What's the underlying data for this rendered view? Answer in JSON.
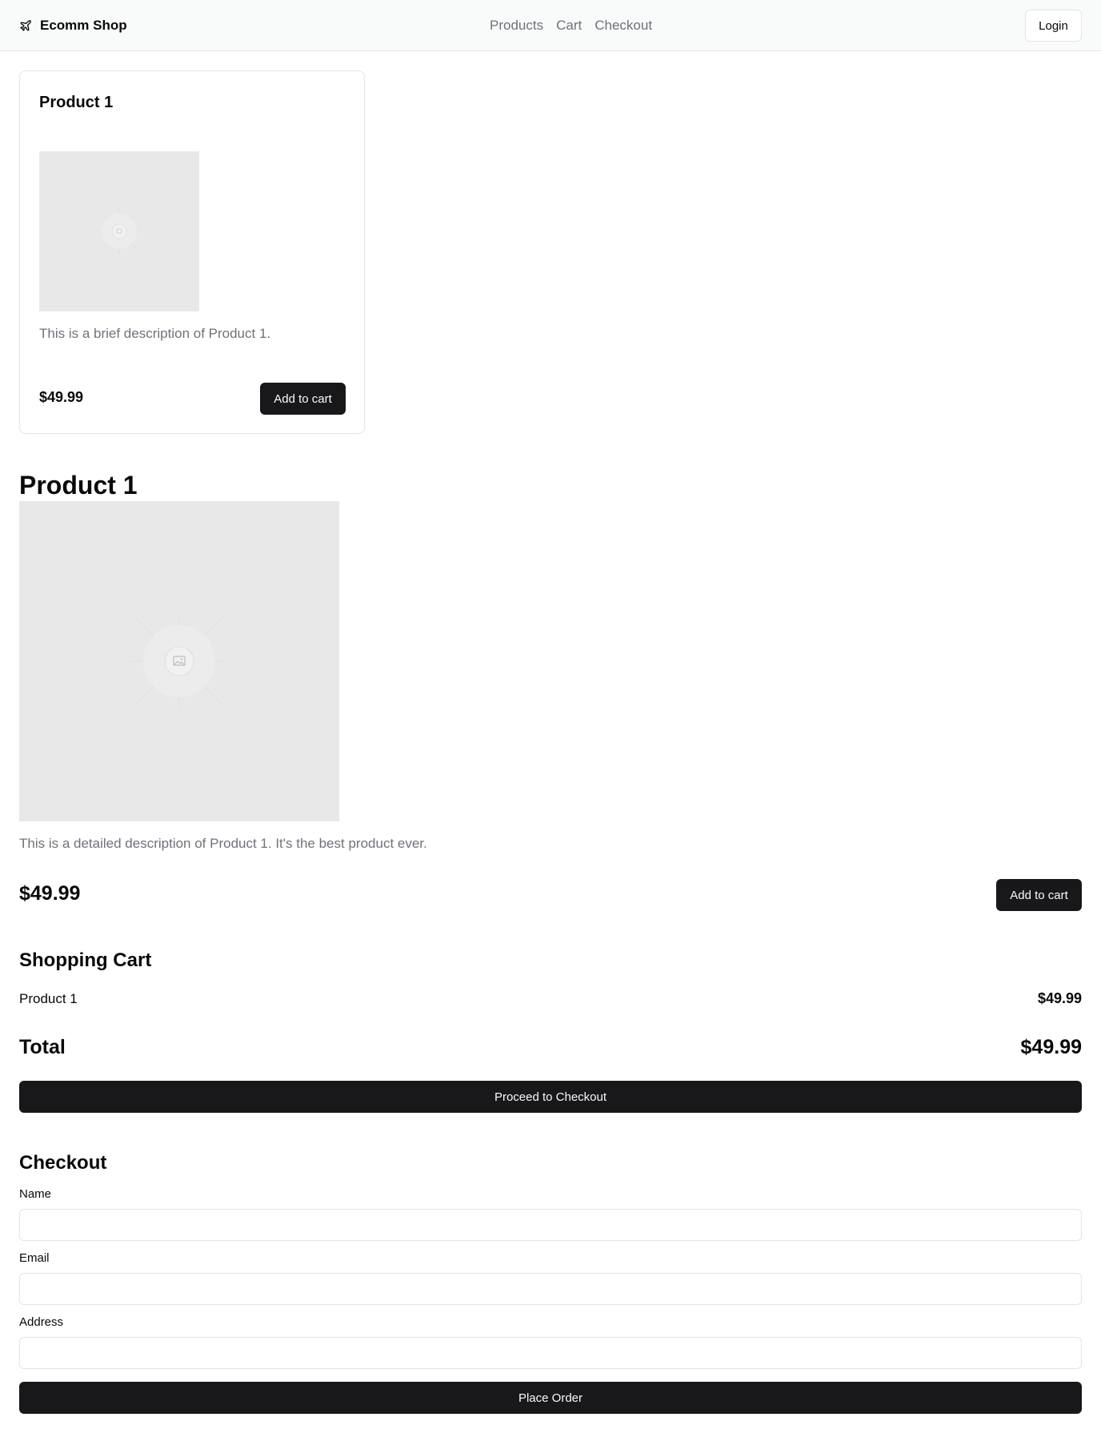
{
  "header": {
    "brand_icon": "plane-icon",
    "brand_name": "Ecomm Shop",
    "nav": [
      "Products",
      "Cart",
      "Checkout"
    ],
    "login_label": "Login"
  },
  "product_card": {
    "title": "Product 1",
    "image_icon": "image-placeholder-icon",
    "description": "This is a brief description of Product 1.",
    "price": "$49.99",
    "add_label": "Add to cart"
  },
  "product_detail": {
    "title": "Product 1",
    "image_icon": "image-placeholder-icon",
    "description": "This is a detailed description of Product 1. It's the best product ever.",
    "price": "$49.99",
    "add_label": "Add to cart"
  },
  "cart": {
    "title": "Shopping Cart",
    "items": [
      {
        "name": "Product 1",
        "price": "$49.99"
      }
    ],
    "total_label": "Total",
    "total_value": "$49.99",
    "checkout_label": "Proceed to Checkout"
  },
  "checkout": {
    "title": "Checkout",
    "fields": [
      {
        "label": "Name",
        "value": "",
        "placeholder": ""
      },
      {
        "label": "Email",
        "value": "",
        "placeholder": ""
      },
      {
        "label": "Address",
        "value": "",
        "placeholder": ""
      }
    ],
    "submit_label": "Place Order"
  },
  "colors": {
    "primary": "#18181b",
    "muted_text": "#71717a",
    "border": "#e4e4e7",
    "header_bg": "#f9fafa",
    "placeholder_bg": "#e8e8e8"
  }
}
